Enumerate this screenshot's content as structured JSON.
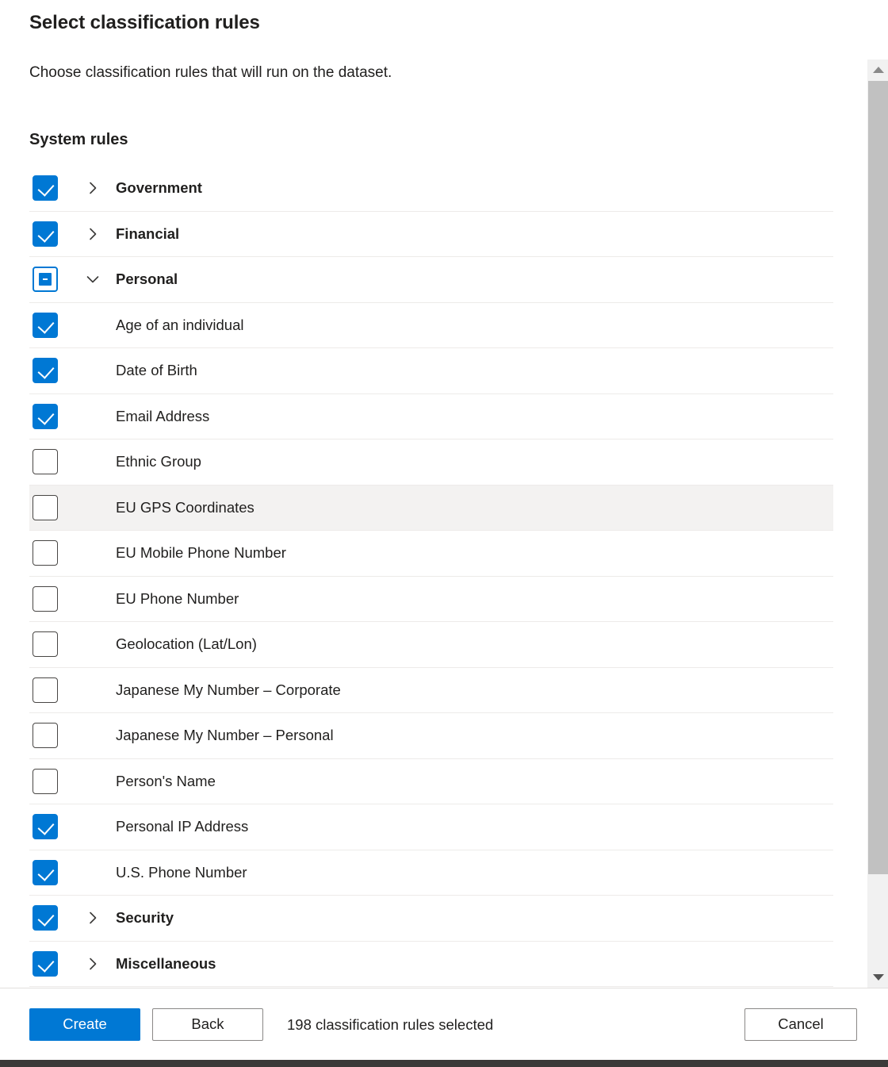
{
  "panel": {
    "title": "Select classification rules",
    "subtitle": "Choose classification rules that will run on the dataset.",
    "section_heading": "System rules"
  },
  "colors": {
    "accent": "#0078d4",
    "row_hover": "#f3f2f1",
    "row_divider": "#edebe9",
    "text": "#201f1e",
    "checkbox_border": "#484644",
    "scrollbar_track": "#f1f1f1",
    "scrollbar_thumb": "#c1c1c1",
    "bottom_bar": "#3b3a39"
  },
  "rules": [
    {
      "label": "Government",
      "level": "group",
      "state": "checked",
      "expanded": false,
      "chevron": "chevron-right-icon",
      "hovered": false
    },
    {
      "label": "Financial",
      "level": "group",
      "state": "checked",
      "expanded": false,
      "chevron": "chevron-right-icon",
      "hovered": false
    },
    {
      "label": "Personal",
      "level": "group",
      "state": "indeterminate",
      "expanded": true,
      "chevron": "chevron-down-icon",
      "hovered": false
    },
    {
      "label": "Age of an individual",
      "level": "child",
      "state": "checked",
      "expanded": null,
      "chevron": null,
      "hovered": false
    },
    {
      "label": "Date of Birth",
      "level": "child",
      "state": "checked",
      "expanded": null,
      "chevron": null,
      "hovered": false
    },
    {
      "label": "Email Address",
      "level": "child",
      "state": "checked",
      "expanded": null,
      "chevron": null,
      "hovered": false
    },
    {
      "label": "Ethnic Group",
      "level": "child",
      "state": "unchecked",
      "expanded": null,
      "chevron": null,
      "hovered": false
    },
    {
      "label": "EU GPS Coordinates",
      "level": "child",
      "state": "unchecked",
      "expanded": null,
      "chevron": null,
      "hovered": true
    },
    {
      "label": "EU Mobile Phone Number",
      "level": "child",
      "state": "unchecked",
      "expanded": null,
      "chevron": null,
      "hovered": false
    },
    {
      "label": "EU Phone Number",
      "level": "child",
      "state": "unchecked",
      "expanded": null,
      "chevron": null,
      "hovered": false
    },
    {
      "label": "Geolocation (Lat/Lon)",
      "level": "child",
      "state": "unchecked",
      "expanded": null,
      "chevron": null,
      "hovered": false
    },
    {
      "label": "Japanese My Number – Corporate",
      "level": "child",
      "state": "unchecked",
      "expanded": null,
      "chevron": null,
      "hovered": false
    },
    {
      "label": "Japanese My Number – Personal",
      "level": "child",
      "state": "unchecked",
      "expanded": null,
      "chevron": null,
      "hovered": false
    },
    {
      "label": "Person's Name",
      "level": "child",
      "state": "unchecked",
      "expanded": null,
      "chevron": null,
      "hovered": false
    },
    {
      "label": "Personal IP Address",
      "level": "child",
      "state": "checked",
      "expanded": null,
      "chevron": null,
      "hovered": false
    },
    {
      "label": "U.S. Phone Number",
      "level": "child",
      "state": "checked",
      "expanded": null,
      "chevron": null,
      "hovered": false
    },
    {
      "label": "Security",
      "level": "group",
      "state": "checked",
      "expanded": false,
      "chevron": "chevron-right-icon",
      "hovered": false
    },
    {
      "label": "Miscellaneous",
      "level": "group",
      "state": "checked",
      "expanded": false,
      "chevron": "chevron-right-icon",
      "hovered": false
    }
  ],
  "scrollbar": {
    "up_arrow": "scroll-up-arrow-icon",
    "down_arrow": "scroll-down-arrow-icon",
    "orientation": "vertical"
  },
  "footer": {
    "create_label": "Create",
    "back_label": "Back",
    "cancel_label": "Cancel",
    "selected_count_text": "198 classification rules selected"
  }
}
